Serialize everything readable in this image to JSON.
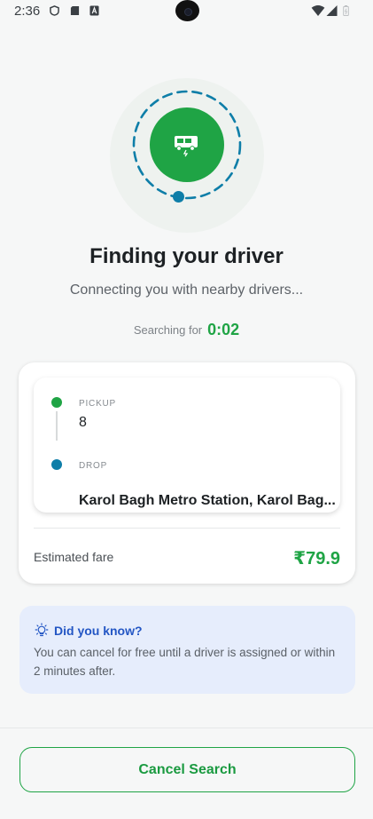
{
  "status_bar": {
    "time": "2:36",
    "left_icons": [
      "shield-icon",
      "sd-card-icon",
      "app-a-icon"
    ],
    "right_icons": [
      "wifi-icon",
      "signal-icon",
      "battery-icon"
    ]
  },
  "search": {
    "title": "Finding your driver",
    "subtitle": "Connecting you with nearby drivers...",
    "timer_label": "Searching for",
    "timer_value": "0:02",
    "vehicle_icon": "auto-rickshaw-icon"
  },
  "trip": {
    "pickup_label": "PICKUP",
    "pickup_value": "8",
    "drop_label": "DROP",
    "drop_value": "Karol Bagh Metro Station, Karol Bag...",
    "fare_label": "Estimated fare",
    "fare_value": "₹79.9"
  },
  "info": {
    "icon": "lightbulb-icon",
    "title": "Did you know?",
    "text": "You can cancel for free until a driver is assigned or within 2 minutes after."
  },
  "actions": {
    "cancel_label": "Cancel Search"
  },
  "colors": {
    "brand_green": "#1fa445",
    "drop_blue": "#0e7ea8",
    "info_bg": "#e6edfc",
    "info_title": "#2356c4"
  }
}
